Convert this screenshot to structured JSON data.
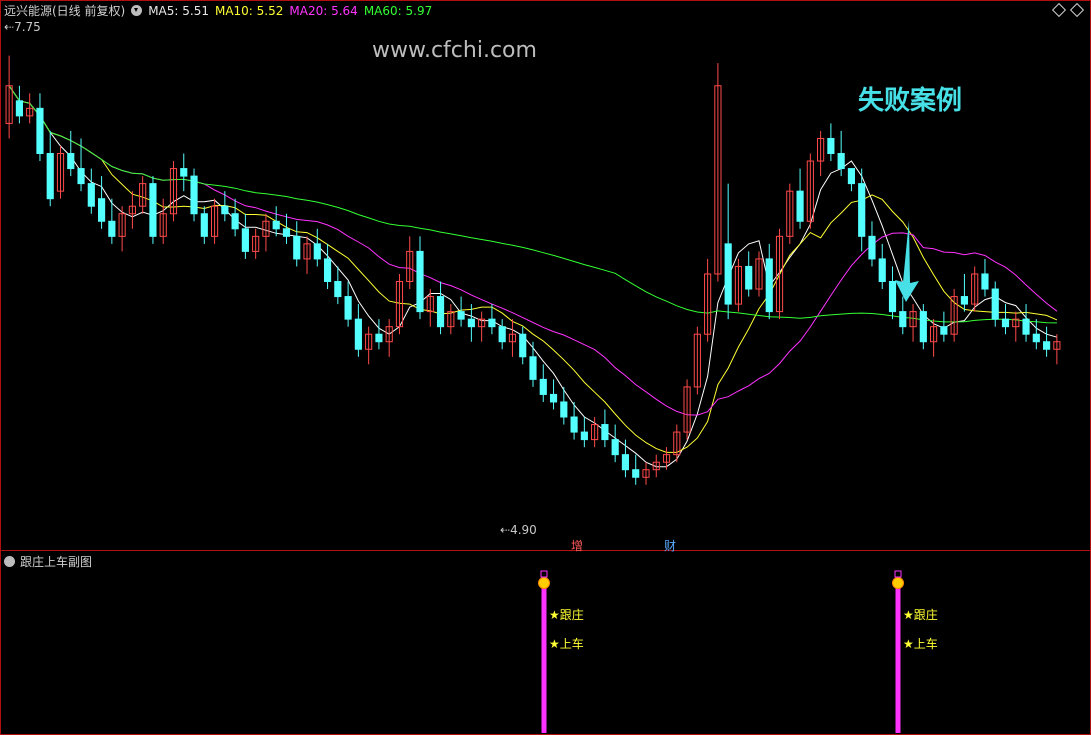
{
  "header": {
    "title": "远兴能源(日线 前复权)",
    "ma5": "MA5: 5.51",
    "ma10": "MA10: 5.52",
    "ma20": "MA20: 5.64",
    "ma60": "MA60: 5.97"
  },
  "watermark": "www.cfchi.com",
  "annotation": "失败案例",
  "markers": {
    "high": "7.75",
    "low": "4.90",
    "event1": "增",
    "event2": "财"
  },
  "subchart": {
    "title": "跟庄上车副图",
    "signal_text1": "★跟庄",
    "signal_text2": "★上车"
  },
  "colors": {
    "bg": "#000000",
    "up": "#ff4a4a",
    "down": "#54ffff",
    "ma5": "#ffffff",
    "ma10": "#ffff33",
    "ma20": "#ff33ff",
    "ma60": "#33ff33",
    "frame": "#b01010",
    "signal": "#ff33ff",
    "annot": "#46e0e6"
  },
  "chart_data": {
    "type": "candlestick",
    "title": "远兴能源(日线 前复权)",
    "price_range": [
      4.5,
      8.0
    ],
    "candles_ohlc": [
      [
        7.3,
        7.75,
        7.2,
        7.55
      ],
      [
        7.45,
        7.55,
        7.3,
        7.35
      ],
      [
        7.35,
        7.5,
        7.3,
        7.4
      ],
      [
        7.4,
        7.5,
        7.05,
        7.1
      ],
      [
        7.1,
        7.25,
        6.75,
        6.8
      ],
      [
        6.85,
        7.15,
        6.8,
        7.1
      ],
      [
        7.1,
        7.25,
        6.95,
        7.0
      ],
      [
        7.0,
        7.2,
        6.85,
        6.9
      ],
      [
        6.9,
        7.0,
        6.7,
        6.75
      ],
      [
        6.8,
        6.95,
        6.6,
        6.65
      ],
      [
        6.65,
        6.8,
        6.5,
        6.55
      ],
      [
        6.55,
        6.75,
        6.45,
        6.7
      ],
      [
        6.7,
        6.85,
        6.6,
        6.75
      ],
      [
        6.75,
        6.95,
        6.7,
        6.9
      ],
      [
        6.9,
        6.95,
        6.5,
        6.55
      ],
      [
        6.55,
        6.8,
        6.5,
        6.7
      ],
      [
        6.7,
        7.05,
        6.65,
        7.0
      ],
      [
        7.0,
        7.1,
        6.85,
        6.95
      ],
      [
        6.95,
        7.0,
        6.65,
        6.7
      ],
      [
        6.7,
        6.75,
        6.5,
        6.55
      ],
      [
        6.55,
        6.8,
        6.5,
        6.75
      ],
      [
        6.75,
        6.85,
        6.65,
        6.7
      ],
      [
        6.7,
        6.8,
        6.55,
        6.6
      ],
      [
        6.6,
        6.7,
        6.4,
        6.45
      ],
      [
        6.45,
        6.6,
        6.4,
        6.55
      ],
      [
        6.55,
        6.7,
        6.45,
        6.65
      ],
      [
        6.65,
        6.75,
        6.55,
        6.6
      ],
      [
        6.6,
        6.7,
        6.5,
        6.55
      ],
      [
        6.55,
        6.65,
        6.35,
        6.4
      ],
      [
        6.4,
        6.55,
        6.3,
        6.5
      ],
      [
        6.5,
        6.6,
        6.35,
        6.4
      ],
      [
        6.4,
        6.5,
        6.2,
        6.25
      ],
      [
        6.25,
        6.35,
        6.1,
        6.15
      ],
      [
        6.15,
        6.25,
        5.95,
        6.0
      ],
      [
        6.0,
        6.1,
        5.75,
        5.8
      ],
      [
        5.8,
        5.95,
        5.7,
        5.9
      ],
      [
        5.9,
        6.0,
        5.8,
        5.85
      ],
      [
        5.85,
        6.0,
        5.75,
        5.95
      ],
      [
        5.95,
        6.3,
        5.9,
        6.25
      ],
      [
        6.25,
        6.55,
        6.2,
        6.45
      ],
      [
        6.45,
        6.55,
        6.0,
        6.05
      ],
      [
        6.05,
        6.2,
        5.95,
        6.15
      ],
      [
        6.15,
        6.25,
        5.9,
        5.95
      ],
      [
        5.95,
        6.1,
        5.9,
        6.05
      ],
      [
        6.05,
        6.15,
        5.95,
        6.0
      ],
      [
        6.0,
        6.1,
        5.85,
        5.95
      ],
      [
        5.95,
        6.05,
        5.85,
        6.0
      ],
      [
        6.0,
        6.1,
        5.9,
        5.95
      ],
      [
        5.95,
        6.0,
        5.8,
        5.85
      ],
      [
        5.85,
        6.0,
        5.75,
        5.9
      ],
      [
        5.9,
        5.95,
        5.7,
        5.75
      ],
      [
        5.75,
        5.85,
        5.55,
        5.6
      ],
      [
        5.6,
        5.7,
        5.45,
        5.5
      ],
      [
        5.5,
        5.6,
        5.4,
        5.45
      ],
      [
        5.45,
        5.55,
        5.3,
        5.35
      ],
      [
        5.35,
        5.45,
        5.2,
        5.25
      ],
      [
        5.25,
        5.35,
        5.15,
        5.2
      ],
      [
        5.2,
        5.35,
        5.15,
        5.3
      ],
      [
        5.3,
        5.4,
        5.15,
        5.2
      ],
      [
        5.2,
        5.3,
        5.05,
        5.1
      ],
      [
        5.1,
        5.2,
        4.95,
        5.0
      ],
      [
        5.0,
        5.1,
        4.9,
        4.95
      ],
      [
        4.95,
        5.05,
        4.9,
        5.0
      ],
      [
        5.0,
        5.1,
        4.95,
        5.05
      ],
      [
        5.05,
        5.15,
        5.0,
        5.1
      ],
      [
        5.1,
        5.3,
        5.05,
        5.25
      ],
      [
        5.25,
        5.6,
        5.2,
        5.55
      ],
      [
        5.55,
        5.95,
        5.5,
        5.9
      ],
      [
        5.9,
        6.4,
        5.85,
        6.3
      ],
      [
        6.3,
        7.7,
        6.25,
        7.55
      ],
      [
        6.5,
        6.9,
        6.0,
        6.1
      ],
      [
        6.1,
        6.4,
        6.05,
        6.35
      ],
      [
        6.35,
        6.45,
        6.15,
        6.2
      ],
      [
        6.2,
        6.45,
        6.15,
        6.4
      ],
      [
        6.4,
        6.5,
        6.0,
        6.05
      ],
      [
        6.05,
        6.6,
        6.0,
        6.55
      ],
      [
        6.55,
        6.9,
        6.5,
        6.85
      ],
      [
        6.85,
        7.0,
        6.6,
        6.65
      ],
      [
        6.65,
        7.1,
        6.6,
        7.05
      ],
      [
        7.05,
        7.25,
        6.95,
        7.2
      ],
      [
        7.2,
        7.3,
        7.05,
        7.1
      ],
      [
        7.1,
        7.25,
        6.95,
        7.0
      ],
      [
        7.0,
        6.95,
        6.85,
        6.9
      ],
      [
        6.9,
        7.0,
        6.45,
        6.55
      ],
      [
        6.55,
        6.65,
        6.35,
        6.4
      ],
      [
        6.4,
        6.5,
        6.2,
        6.25
      ],
      [
        6.25,
        6.35,
        6.0,
        6.05
      ],
      [
        6.05,
        6.15,
        5.9,
        5.95
      ],
      [
        5.95,
        6.1,
        5.85,
        6.05
      ],
      [
        6.05,
        6.1,
        5.8,
        5.85
      ],
      [
        5.85,
        6.0,
        5.75,
        5.95
      ],
      [
        5.95,
        6.05,
        5.85,
        5.9
      ],
      [
        5.9,
        6.2,
        5.85,
        6.15
      ],
      [
        6.15,
        6.3,
        6.05,
        6.1
      ],
      [
        6.1,
        6.35,
        6.05,
        6.3
      ],
      [
        6.3,
        6.4,
        6.15,
        6.2
      ],
      [
        6.2,
        6.25,
        5.95,
        6.0
      ],
      [
        6.0,
        6.1,
        5.9,
        5.95
      ],
      [
        5.95,
        6.05,
        5.85,
        6.0
      ],
      [
        6.0,
        6.1,
        5.85,
        5.9
      ],
      [
        5.9,
        6.0,
        5.8,
        5.85
      ],
      [
        5.85,
        5.95,
        5.75,
        5.8
      ],
      [
        5.8,
        5.9,
        5.7,
        5.85
      ]
    ],
    "ma_labels": [
      "MA5: 5.51",
      "MA10: 5.52",
      "MA20: 5.64",
      "MA60: 5.97"
    ],
    "high_label": "7.75",
    "low_label": "4.90",
    "annotation": "失败案例",
    "subchart_signals": [
      "★跟庄",
      "★上车"
    ]
  }
}
